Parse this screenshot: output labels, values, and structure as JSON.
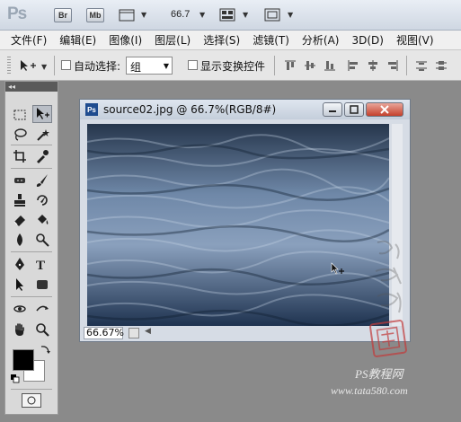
{
  "app": {
    "logo": "Ps",
    "bridge_button": "Br",
    "minibridge_button": "Mb",
    "zoom_level": "66.7"
  },
  "menubar": {
    "items": [
      "文件(F)",
      "编辑(E)",
      "图像(I)",
      "图层(L)",
      "选择(S)",
      "滤镜(T)",
      "分析(A)",
      "3D(D)",
      "视图(V)"
    ]
  },
  "options_bar": {
    "auto_select_label": "自动选择:",
    "auto_select_checked": false,
    "auto_select_value": "组",
    "show_transform_label": "显示变换控件",
    "show_transform_checked": false
  },
  "toolbox": {
    "collapse_glyph": "◂◂",
    "foreground_color": "#000000",
    "background_color": "#ffffff",
    "tools": [
      "marquee-icon",
      "move-icon",
      "lasso-icon",
      "magic-wand-icon",
      "crop-icon",
      "eyedropper-icon",
      "healing-brush-icon",
      "brush-icon",
      "clone-stamp-icon",
      "history-brush-icon",
      "eraser-icon",
      "paint-bucket-icon",
      "blur-icon",
      "dodge-icon",
      "pen-icon",
      "type-icon",
      "path-selection-icon",
      "rectangle-icon",
      "3d-rotate-icon",
      "3d-orbit-icon",
      "hand-icon",
      "zoom-icon"
    ]
  },
  "document": {
    "title": "source02.jpg @ 66.7%(RGB/8#)",
    "zoom_field": "66.67%"
  },
  "watermark": {
    "line1": "PS教程网",
    "line2": "www.tata580.com",
    "seal_text": "他他教程"
  },
  "colors": {
    "accent": "#1f4c8f",
    "close_button": "#c4402c"
  }
}
